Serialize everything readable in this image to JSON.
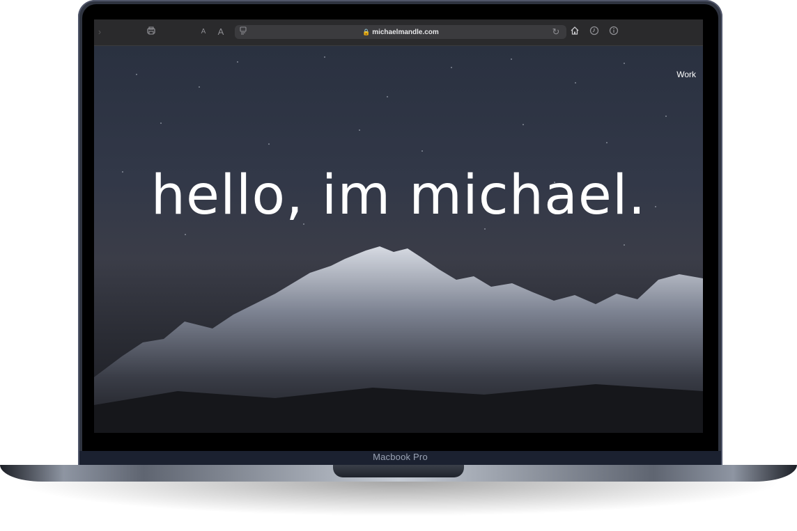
{
  "browser": {
    "url": "michaelmandle.com",
    "icons": [
      "back-icon",
      "print-icon",
      "text-small-icon",
      "text-large-icon",
      "reader-icon",
      "lock-icon",
      "reload-icon",
      "home-icon",
      "history-icon",
      "info-icon"
    ],
    "text_small": "A",
    "text_large": "A"
  },
  "site": {
    "nav_work": "Work",
    "hero_heading": "hello, im michael."
  },
  "device": {
    "label": "Macbook Pro"
  }
}
